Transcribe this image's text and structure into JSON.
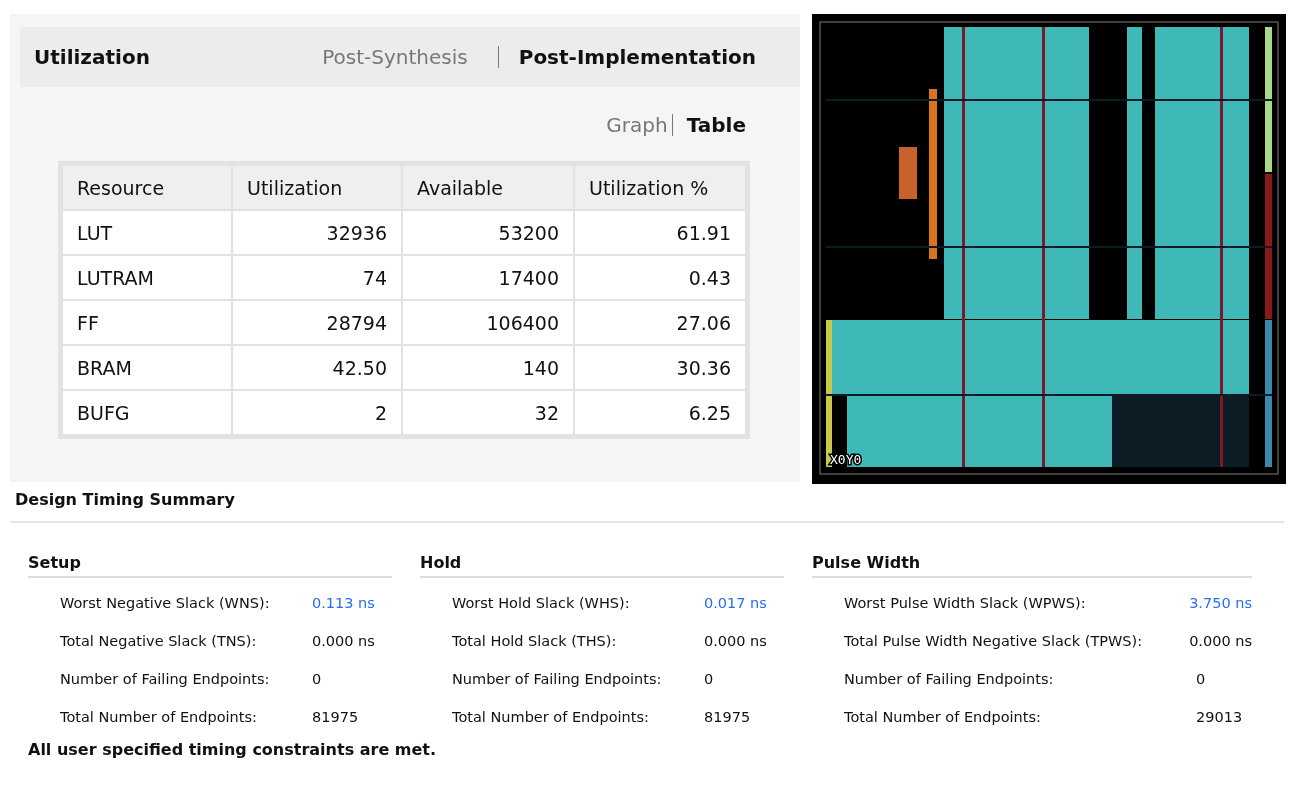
{
  "utilization": {
    "title": "Utilization",
    "stage_tabs": [
      {
        "label": "Post-Synthesis",
        "selected": false
      },
      {
        "label": "Post-Implementation",
        "selected": true
      }
    ],
    "view_tabs": [
      {
        "label": "Graph",
        "selected": false
      },
      {
        "label": "Table",
        "selected": true
      }
    ],
    "table": {
      "columns": [
        "Resource",
        "Utilization",
        "Available",
        "Utilization %"
      ],
      "rows": [
        [
          "LUT",
          "32936",
          "53200",
          "61.91"
        ],
        [
          "LUTRAM",
          "74",
          "17400",
          "0.43"
        ],
        [
          "FF",
          "28794",
          "106400",
          "27.06"
        ],
        [
          "BRAM",
          "42.50",
          "140",
          "30.36"
        ],
        [
          "BUFG",
          "2",
          "32",
          "6.25"
        ]
      ]
    }
  },
  "device_view": {
    "region_label": "X0Y0"
  },
  "timing": {
    "title": "Design Timing Summary",
    "groups": [
      {
        "title": "Setup",
        "rows": [
          {
            "label": "Worst Negative Slack (WNS):",
            "value": "0.113 ns",
            "link": true
          },
          {
            "label": "Total Negative Slack (TNS):",
            "value": "0.000 ns",
            "link": false
          },
          {
            "label": "Number of Failing Endpoints:",
            "value": "0",
            "link": false
          },
          {
            "label": "Total Number of Endpoints:",
            "value": "81975",
            "link": false
          }
        ]
      },
      {
        "title": "Hold",
        "rows": [
          {
            "label": "Worst Hold Slack (WHS):",
            "value": "0.017 ns",
            "link": true
          },
          {
            "label": "Total Hold Slack (THS):",
            "value": "0.000 ns",
            "link": false
          },
          {
            "label": "Number of Failing Endpoints:",
            "value": "0",
            "link": false
          },
          {
            "label": "Total Number of Endpoints:",
            "value": "81975",
            "link": false
          }
        ]
      },
      {
        "title": "Pulse Width",
        "rows": [
          {
            "label": "Worst Pulse Width Slack (WPWS):",
            "value": "3.750 ns",
            "link": true
          },
          {
            "label": "Total Pulse Width Negative Slack (TPWS):",
            "value": "0.000 ns",
            "link": false
          },
          {
            "label": "Number of Failing Endpoints:",
            "value": "0",
            "link": false
          },
          {
            "label": "Total Number of Endpoints:",
            "value": "29013",
            "link": false
          }
        ]
      }
    ],
    "footer": "All user specified timing constraints are met."
  }
}
